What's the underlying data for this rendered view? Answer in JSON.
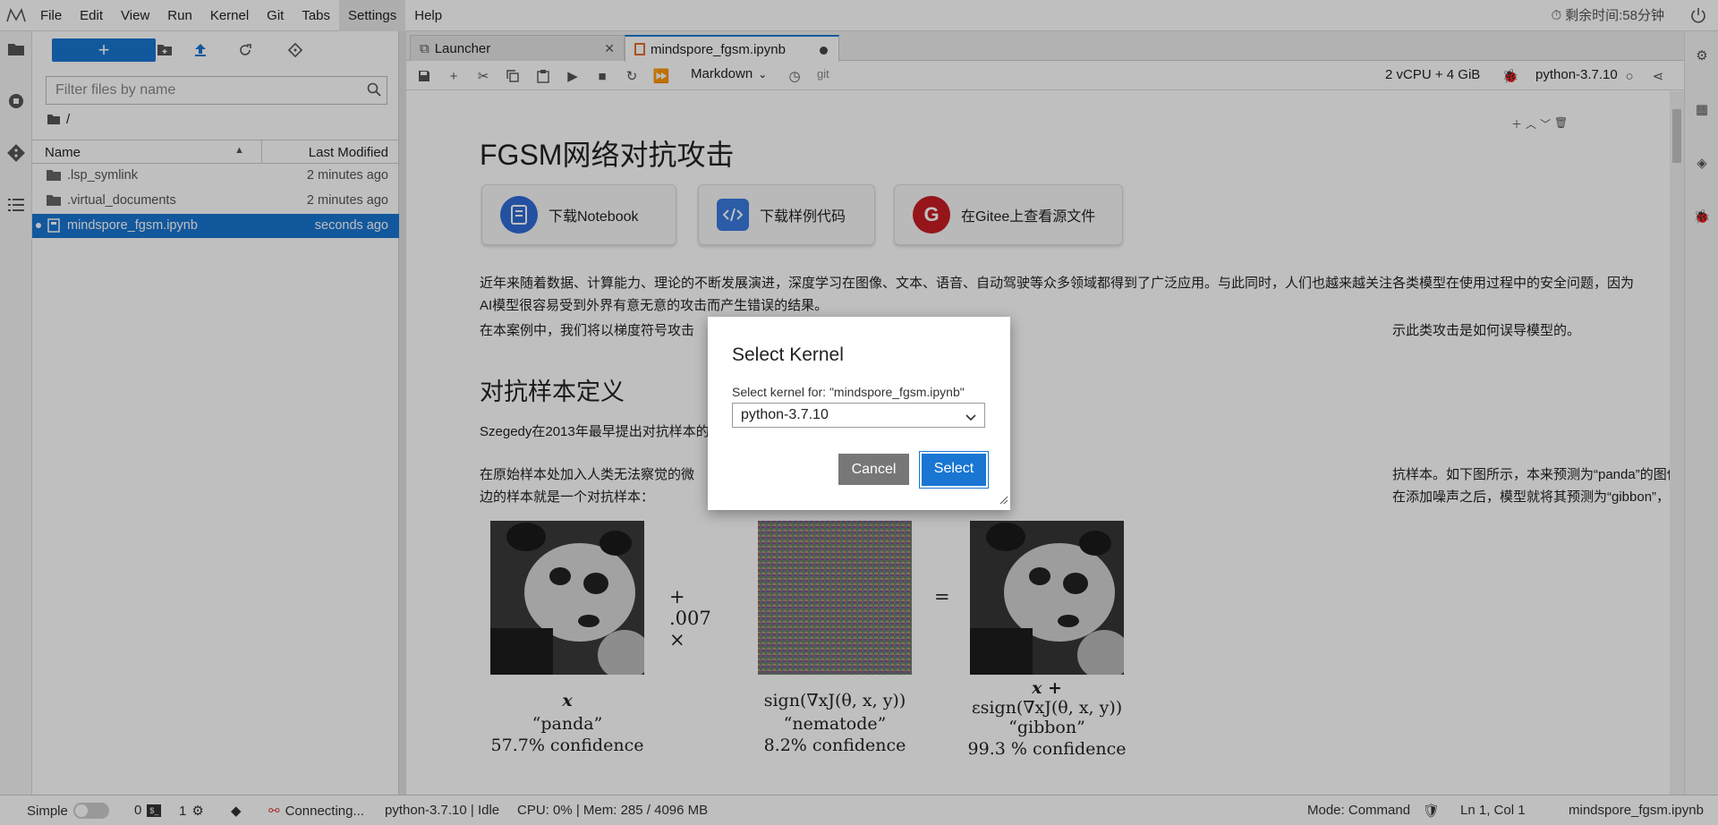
{
  "menubar": {
    "items": [
      "File",
      "Edit",
      "View",
      "Run",
      "Kernel",
      "Git",
      "Tabs",
      "Settings",
      "Help"
    ],
    "timer": "剩余时间:58分钟"
  },
  "filebrowser": {
    "filter_placeholder": "Filter files by name",
    "breadcrumb": "/",
    "col_name": "Name",
    "col_modified": "Last Modified",
    "files": [
      {
        "name": ".lsp_symlink",
        "modified": "2 minutes ago",
        "type": "folder"
      },
      {
        "name": ".virtual_documents",
        "modified": "2 minutes ago",
        "type": "folder"
      },
      {
        "name": "mindspore_fgsm.ipynb",
        "modified": "seconds ago",
        "type": "notebook"
      }
    ]
  },
  "tabs": [
    {
      "label": "Launcher"
    },
    {
      "label": "mindspore_fgsm.ipynb"
    }
  ],
  "toolbar": {
    "cell_type": "Markdown",
    "git": "git",
    "resources": "2 vCPU + 4 GiB",
    "kernel": "python-3.7.10"
  },
  "notebook": {
    "title": "FGSM网络对抗攻击",
    "links": [
      "下载Notebook",
      "下载样例代码",
      "在Gitee上查看源文件"
    ],
    "para1": "近年来随着数据、计算能力、理论的不断发展演进，深度学习在图像、文本、语音、自动驾驶等众多领域都得到了广泛应用。与此同时，人们也越来越关注各类模型在使用过程中的安全问题，因为AI模型很容易受到外界有意无意的攻击而产生错误的结果。",
    "para2_left": "在本案例中，我们将以梯度符号攻击",
    "para2_right": "示此类攻击是如何误导模型的。",
    "h2": "对抗样本定义",
    "para3": "Szegedy在2013年最早提出对抗样本的",
    "para4_left": "在原始样本处加入人类无法察觉的微",
    "para4_right": "抗样本。如下图所示，本来预测为“panda”的图像在添加噪声之后，模型就将其预测为“gibbon”，右",
    "para4_line2": "边的样本就是一个对抗样本：",
    "figure": {
      "op_plus": "+ .007 ×",
      "op_eq": "=",
      "panels": [
        {
          "formula": "x",
          "label": "“panda”",
          "confidence": "57.7% confidence"
        },
        {
          "formula": "sign(∇xJ(θ, x, y))",
          "label": "“nematode”",
          "confidence": "8.2% confidence"
        },
        {
          "formula_top": "x +",
          "formula": "εsign(∇xJ(θ, x, y))",
          "label": "“gibbon”",
          "confidence": "99.3 % confidence"
        }
      ]
    }
  },
  "dialog": {
    "title": "Select Kernel",
    "label": "Select kernel for: \"mindspore_fgsm.ipynb\"",
    "selected": "python-3.7.10",
    "cancel": "Cancel",
    "select": "Select"
  },
  "statusbar": {
    "mode_label": "Simple",
    "terminals": "0",
    "kernels": "1",
    "connection": "Connecting...",
    "kernel_status": "python-3.7.10 | Idle",
    "cpu_mem": "CPU: 0% | Mem: 285 / 4096 MB",
    "mode": "Mode: Command",
    "position": "Ln 1, Col 1",
    "filename": "mindspore_fgsm.ipynb"
  },
  "colors": {
    "accent": "#1976d2",
    "gitee": "#c71d23"
  }
}
